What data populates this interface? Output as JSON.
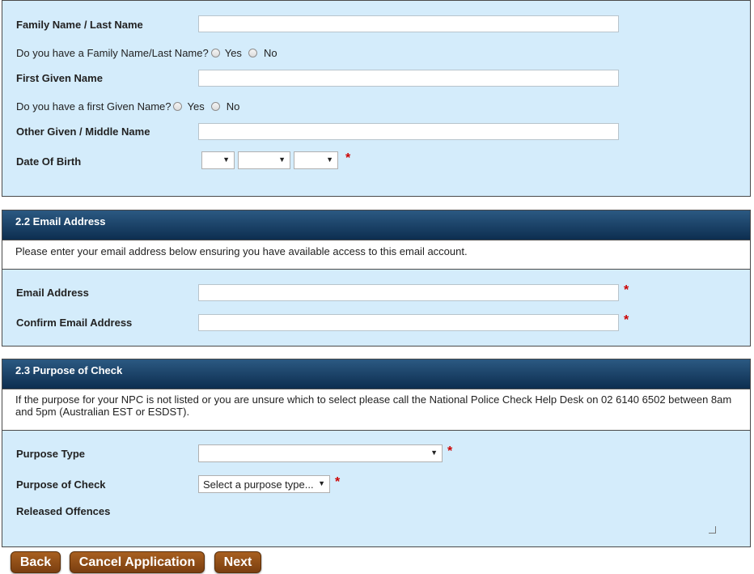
{
  "personal": {
    "family_name_label": "Family Name / Last Name",
    "family_name_question": "Do you have a Family Name/Last Name?",
    "first_given_label": "First Given Name",
    "first_given_question": "Do you have a first Given Name?",
    "middle_name_label": "Other Given / Middle Name",
    "dob_label": "Date Of Birth",
    "yes": "Yes",
    "no": "No",
    "required_mark": "*"
  },
  "email": {
    "header": "2.2 Email Address",
    "info": "Please enter your email address below ensuring you have available access to this email account.",
    "email_label": "Email Address",
    "confirm_label": "Confirm Email Address"
  },
  "purpose": {
    "header": "2.3 Purpose of Check",
    "info": "If the purpose for your NPC is not listed or you are unsure which to select please call the National Police Check Help Desk on 02 6140 6502 between 8am and 5pm (Australian EST or ESDST).",
    "type_label": "Purpose Type",
    "check_label": "Purpose of Check",
    "check_value": "Select a purpose type...",
    "released_label": "Released Offences"
  },
  "buttons": {
    "back": "Back",
    "cancel": "Cancel Application",
    "next": "Next"
  },
  "icons": {
    "dropdown_arrow": "▼"
  }
}
